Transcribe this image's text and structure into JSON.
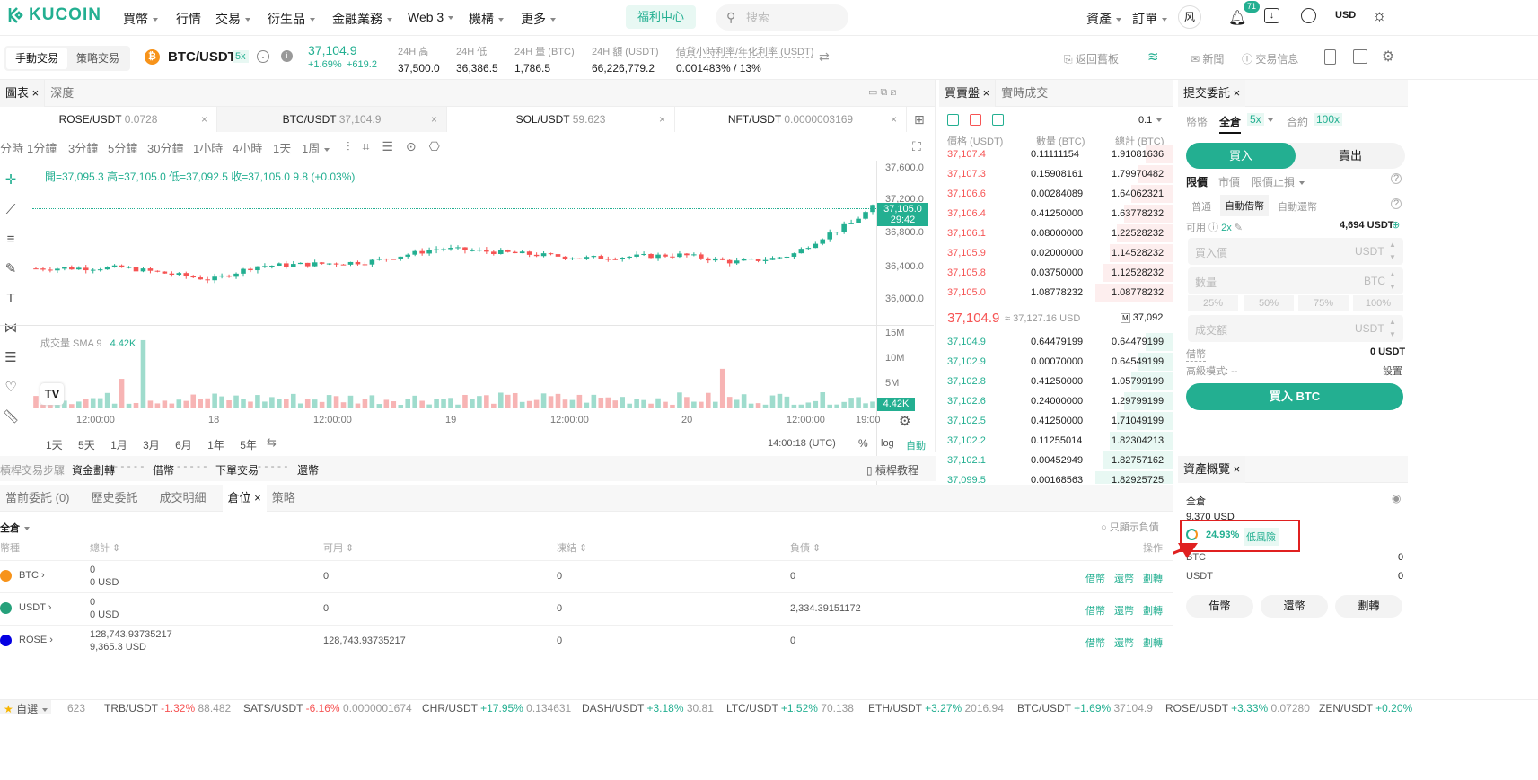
{
  "nav": {
    "brand": "KUCOIN",
    "items": [
      "買幣",
      "行情",
      "交易",
      "衍生品",
      "金融業務",
      "Web 3",
      "機構",
      "更多"
    ],
    "welfare": "福利中心",
    "search_placeholder": "搜索",
    "assets": "資產",
    "orders": "訂單",
    "avatar": "风",
    "notif_count": "71",
    "currency": "USD"
  },
  "ticker": {
    "mode_manual": "手動交易",
    "mode_strategy": "策略交易",
    "pair": "BTC/USDT",
    "leverage": "5x",
    "price": "37,104.9",
    "change_pct": "+1.69%",
    "change_abs": "+619.2",
    "stats": [
      {
        "label": "24H 高",
        "value": "37,500.0"
      },
      {
        "label": "24H 低",
        "value": "36,386.5"
      },
      {
        "label": "24H 量 (BTC)",
        "value": "1,786.5"
      },
      {
        "label": "24H 額 (USDT)",
        "value": "66,226,779.2"
      },
      {
        "label": "借貸小時利率/年化利率 (USDT)",
        "value": "0.001483% / 13%"
      }
    ],
    "right": [
      "返回舊板",
      "新聞",
      "交易信息"
    ]
  },
  "chart": {
    "tabs": [
      "圖表",
      "深度"
    ],
    "pairs": [
      {
        "name": "ROSE/USDT",
        "price": "0.0728"
      },
      {
        "name": "BTC/USDT",
        "price": "37,104.9"
      },
      {
        "name": "SOL/USDT",
        "price": "59.623"
      },
      {
        "name": "NFT/USDT",
        "price": "0.0000003169"
      }
    ],
    "timeframes": [
      "分時",
      "1分鐘",
      "3分鐘",
      "5分鐘",
      "30分鐘",
      "1小時",
      "4小時",
      "1天",
      "1周"
    ],
    "active_tf": "30分鐘",
    "ohlc": {
      "open": "開=37,095.3",
      "high": "高=37,105.0",
      "low": "低=37,092.5",
      "close": "收=37,105.0",
      "chg": "9.8 (+0.03%)"
    },
    "price_axis": [
      "37,600.0",
      "37,200.0",
      "36,800.0",
      "36,400.0",
      "36,000.0"
    ],
    "current_price_tag": "37,105.0",
    "countdown": "29:42",
    "volume_label": "成交量 SMA 9",
    "volume_value": "4.42K",
    "vol_axis": [
      "15M",
      "10M",
      "5M"
    ],
    "vol_tag": "4.42K",
    "time_axis": [
      "12:00:00",
      "18",
      "12:00:00",
      "19",
      "12:00:00",
      "20",
      "12:00:00",
      "19:00"
    ],
    "ranges": [
      "1天",
      "5天",
      "1月",
      "3月",
      "6月",
      "1年",
      "5年"
    ],
    "clock": "14:00:18 (UTC)",
    "scale_opts": [
      "%",
      "log",
      "自動"
    ]
  },
  "steps": {
    "label": "槓桿交易步驟",
    "items": [
      "資金劃轉",
      "借幣",
      "下單交易",
      "還幣"
    ],
    "tutorial": "槓桿教程"
  },
  "orderbook": {
    "tabs": [
      "買賣盤",
      "實時成交"
    ],
    "precision": "0.1",
    "headers": [
      "價格 (USDT)",
      "數量 (BTC)",
      "總計 (BTC)"
    ],
    "asks": [
      [
        "37,107.4",
        "0.11111154",
        "1.91081636"
      ],
      [
        "37,107.3",
        "0.15908161",
        "1.79970482"
      ],
      [
        "37,106.6",
        "0.00284089",
        "1.64062321"
      ],
      [
        "37,106.4",
        "0.41250000",
        "1.63778232"
      ],
      [
        "37,106.1",
        "0.08000000",
        "1.22528232"
      ],
      [
        "37,105.9",
        "0.02000000",
        "1.14528232"
      ],
      [
        "37,105.8",
        "0.03750000",
        "1.12528232"
      ],
      [
        "37,105.0",
        "1.08778232",
        "1.08778232"
      ]
    ],
    "mid_price": "37,104.9",
    "mid_usd": "≈ 37,127.16 USD",
    "mark": "37,092",
    "bids": [
      [
        "37,104.9",
        "0.64479199",
        "0.64479199"
      ],
      [
        "37,102.9",
        "0.00070000",
        "0.64549199"
      ],
      [
        "37,102.8",
        "0.41250000",
        "1.05799199"
      ],
      [
        "37,102.6",
        "0.24000000",
        "1.29799199"
      ],
      [
        "37,102.5",
        "0.41250000",
        "1.71049199"
      ],
      [
        "37,102.2",
        "0.11255014",
        "1.82304213"
      ],
      [
        "37,102.1",
        "0.00452949",
        "1.82757162"
      ],
      [
        "37,099.5",
        "0.00168563",
        "1.82925725"
      ]
    ]
  },
  "form": {
    "title": "提交委託",
    "modes": [
      "幣幣",
      "全倉",
      "5x",
      "合約",
      "100x"
    ],
    "buy": "買入",
    "sell": "賣出",
    "order_types": [
      "限價",
      "市價",
      "限價止損"
    ],
    "borrow_modes": [
      "普通",
      "自動借幣",
      "自動還幣"
    ],
    "available_label": "可用",
    "avail_lev": "2x",
    "available": "4,694 USDT",
    "price_ph": "買入價",
    "price_unit": "USDT",
    "qty_ph": "數量",
    "qty_unit": "BTC",
    "pcts": [
      "25%",
      "50%",
      "75%",
      "100%"
    ],
    "total_ph": "成交額",
    "total_unit": "USDT",
    "borrow_label": "借幣",
    "borrow_val": "0 USDT",
    "adv_label": "高級模式: --",
    "adv_set": "設置",
    "submit": "買入 BTC"
  },
  "assets": {
    "title": "資產概覽",
    "mode": "全倉",
    "total": "9,370 USD",
    "risk_pct": "24.93%",
    "risk_label": "低風險",
    "rows": [
      {
        "c": "BTC",
        "v": "0"
      },
      {
        "c": "USDT",
        "v": "0"
      }
    ],
    "buttons": [
      "借幣",
      "還幣",
      "劃轉"
    ]
  },
  "positions": {
    "tabs": [
      "當前委託 (0)",
      "歷史委託",
      "成交明細",
      "倉位",
      "策略"
    ],
    "mode": "全倉",
    "only_debt": "只顯示負債",
    "headers": [
      "幣種",
      "總計",
      "可用",
      "凍結",
      "負債",
      "操作"
    ],
    "rows": [
      {
        "coin": "BTC",
        "total": "0",
        "total_usd": "0 USD",
        "avail": "0",
        "frozen": "0",
        "debt": "0"
      },
      {
        "coin": "USDT",
        "total": "0",
        "total_usd": "0 USD",
        "avail": "0",
        "frozen": "0",
        "debt": "2,334.39151172"
      },
      {
        "coin": "ROSE",
        "total": "128,743.93735217",
        "total_usd": "9,365.3 USD",
        "avail": "128,743.93735217",
        "frozen": "0",
        "debt": "0"
      }
    ],
    "actions": [
      "借幣",
      "還幣",
      "劃轉"
    ]
  },
  "bottom": {
    "fav": "自選",
    "items": [
      {
        "pair": "",
        "chg": "",
        "price": "623"
      },
      {
        "pair": "TRB/USDT",
        "chg": "-1.32%",
        "price": "88.482"
      },
      {
        "pair": "SATS/USDT",
        "chg": "-6.16%",
        "price": "0.0000001674"
      },
      {
        "pair": "CHR/USDT",
        "chg": "+17.95%",
        "price": "0.134631"
      },
      {
        "pair": "DASH/USDT",
        "chg": "+3.18%",
        "price": "30.81"
      },
      {
        "pair": "LTC/USDT",
        "chg": "+1.52%",
        "price": "70.138"
      },
      {
        "pair": "ETH/USDT",
        "chg": "+3.27%",
        "price": "2016.94"
      },
      {
        "pair": "BTC/USDT",
        "chg": "+1.69%",
        "price": "37104.9"
      },
      {
        "pair": "ROSE/USDT",
        "chg": "+3.33%",
        "price": "0.07280"
      },
      {
        "pair": "ZEN/USDT",
        "chg": "+0.20%",
        "price": ""
      }
    ]
  },
  "colors": {
    "brand": "#23af91",
    "down": "#f65454",
    "annotation": "#e02020"
  }
}
